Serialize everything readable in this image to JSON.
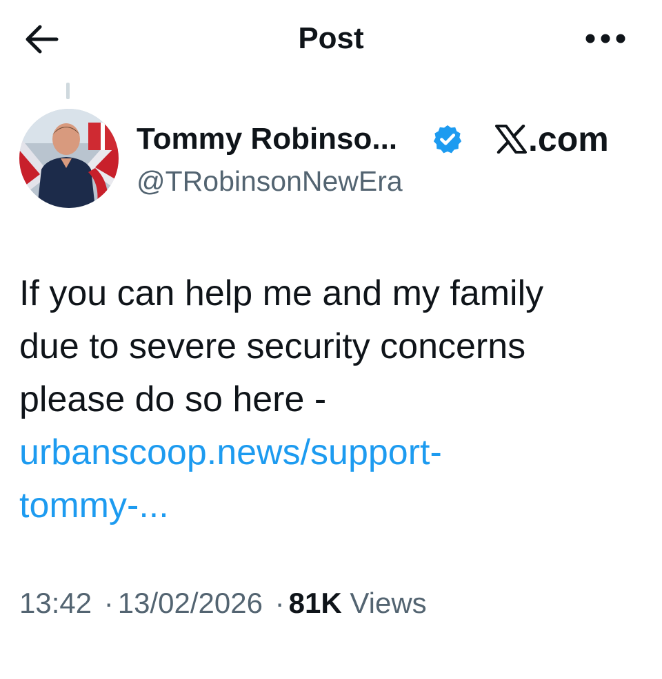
{
  "header": {
    "title": "Post",
    "back_icon": "arrow-left-icon",
    "more_icon": "more-horizontal-icon"
  },
  "author": {
    "display_name": "Tommy Robinso...",
    "handle": "@TRobinsonNewEra",
    "verified": true,
    "verified_color": "#1d9bf0"
  },
  "watermark": {
    "logo_icon": "x-logo-icon",
    "text": ".com"
  },
  "post": {
    "text_lines": [
      "If you can help me and my family",
      "due to severe security concerns",
      "please do so here -"
    ],
    "link_lines": [
      "urbanscoop.news/support-",
      "tommy-..."
    ],
    "link_color": "#1d9bf0"
  },
  "meta": {
    "time": "13:42",
    "separator": "·",
    "date": "13/02/2026",
    "views_count": "81K",
    "views_label": "Views"
  }
}
